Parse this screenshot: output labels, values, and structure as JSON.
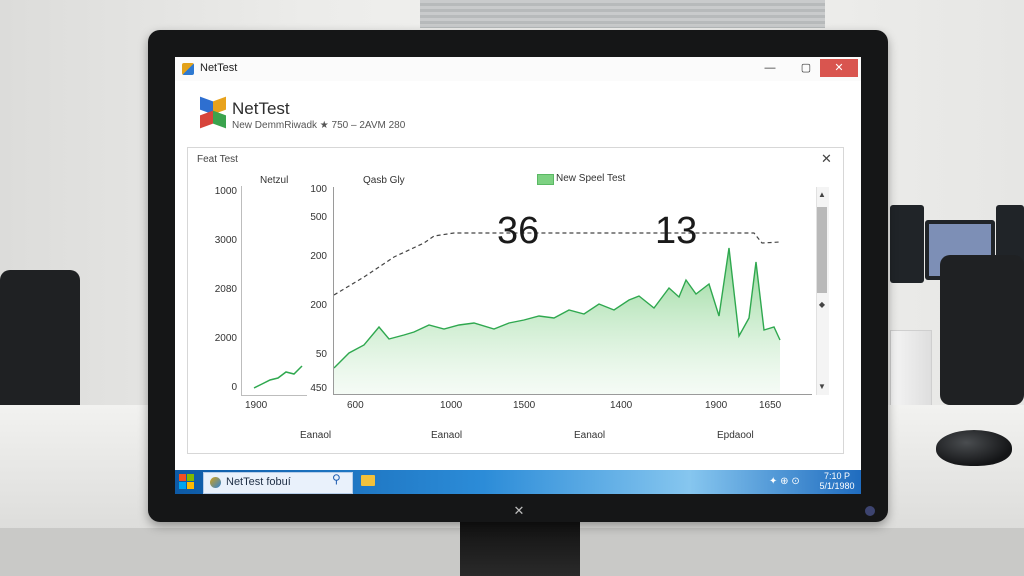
{
  "window": {
    "title": "NetTest",
    "minimize": "—",
    "maximize": "▢",
    "close": "✕"
  },
  "header": {
    "app_name": "NetTest",
    "subtitle": "New DemmRiwadk ★ 750 – 2AVM 280"
  },
  "panel": {
    "title": "Feat Test",
    "close": "✕"
  },
  "mini_chart": {
    "label": "Netzul",
    "y_ticks": [
      "1000",
      "3000",
      "2080",
      "2000",
      "0"
    ],
    "x_tick": "1900",
    "x_label": "Eanaol"
  },
  "chart_data": {
    "type": "area",
    "title": "Qasb Gly",
    "legend": [
      "New Speel Test"
    ],
    "y_ticks": [
      "100",
      "500",
      "200",
      "200",
      "50",
      "450"
    ],
    "x_ticks": [
      "600",
      "1000",
      "1500",
      "1400",
      "1900",
      "1650"
    ],
    "x_labels": [
      "Eanaol",
      "Eanaol",
      "Eanaol",
      "Epdaool"
    ],
    "readouts": [
      "36",
      "13"
    ],
    "colors": {
      "area": "#8fd495",
      "line": "#2fa84f",
      "dashed": "#444444"
    }
  },
  "taskbar": {
    "app_label": "NetTest fobuí",
    "search_icon": "⚲",
    "tray": "✦ ⊕ ⊙",
    "clock_time": "7:10 P",
    "clock_date": "5/1/1980"
  },
  "scrollbar": {
    "up": "▲",
    "down": "▼",
    "mid": "◆"
  }
}
